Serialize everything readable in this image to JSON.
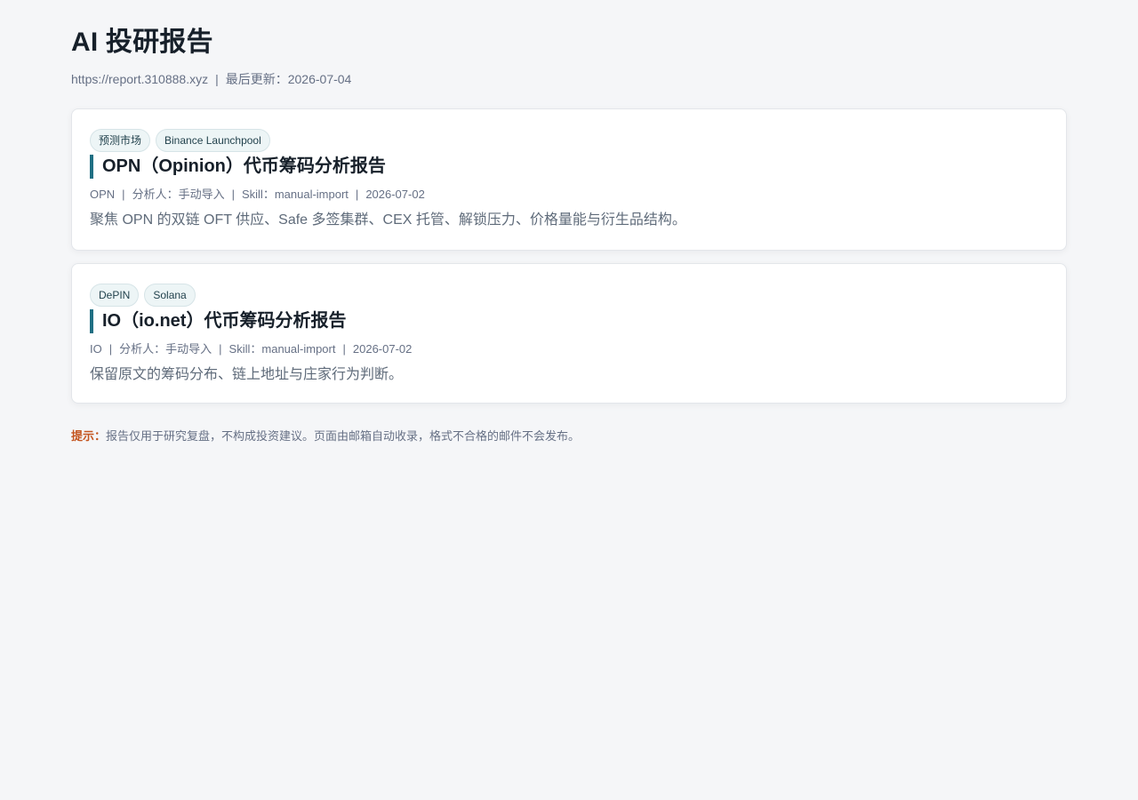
{
  "header": {
    "title": "AI 投研报告",
    "site_url": "https://report.310888.xyz",
    "separator": "|",
    "updated_label": "最后更新：",
    "updated_date": "2026-07-04"
  },
  "reports": [
    {
      "tags": [
        "预测市场",
        "Binance Launchpool"
      ],
      "title": "OPN（Opinion）代币筹码分析报告",
      "meta": {
        "token": "OPN",
        "analyst_label": "分析人：",
        "analyst": "手动导入",
        "skill_label": "Skill：",
        "skill": "manual-import",
        "date": "2026-07-02"
      },
      "summary": "聚焦 OPN 的双链 OFT 供应、Safe 多签集群、CEX 托管、解锁压力、价格量能与衍生品结构。"
    },
    {
      "tags": [
        "DePIN",
        "Solana"
      ],
      "title": "IO（io.net）代币筹码分析报告",
      "meta": {
        "token": "IO",
        "analyst_label": "分析人：",
        "analyst": "手动导入",
        "skill_label": "Skill：",
        "skill": "manual-import",
        "date": "2026-07-02"
      },
      "summary": "保留原文的筹码分布、链上地址与庄家行为判断。"
    }
  ],
  "notice": {
    "label": "提示：",
    "text": "报告仅用于研究复盘，不构成投资建议。页面由邮箱自动收录，格式不合格的邮件不会发布。"
  },
  "colors": {
    "background": "#f5f6f8",
    "accent": "#1f6f83",
    "notice_label": "#c4551f",
    "muted_text": "#667085"
  }
}
